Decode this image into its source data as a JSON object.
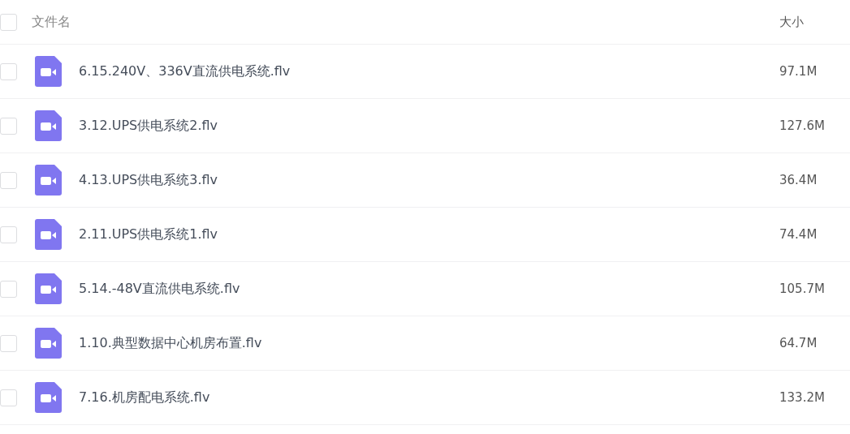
{
  "header": {
    "checked": false,
    "name_label": "文件名",
    "size_label": "大小"
  },
  "files": [
    {
      "name": "6.15.240V、336V直流供电系统.flv",
      "size": "97.1M",
      "checked": false
    },
    {
      "name": "3.12.UPS供电系统2.flv",
      "size": "127.6M",
      "checked": false
    },
    {
      "name": "4.13.UPS供电系统3.flv",
      "size": "36.4M",
      "checked": false
    },
    {
      "name": "2.11.UPS供电系统1.flv",
      "size": "74.4M",
      "checked": false
    },
    {
      "name": "5.14.-48V直流供电系统.flv",
      "size": "105.7M",
      "checked": false
    },
    {
      "name": "1.10.典型数据中心机房布置.flv",
      "size": "64.7M",
      "checked": false
    },
    {
      "name": "7.16.机房配电系统.flv",
      "size": "133.2M",
      "checked": false
    }
  ]
}
